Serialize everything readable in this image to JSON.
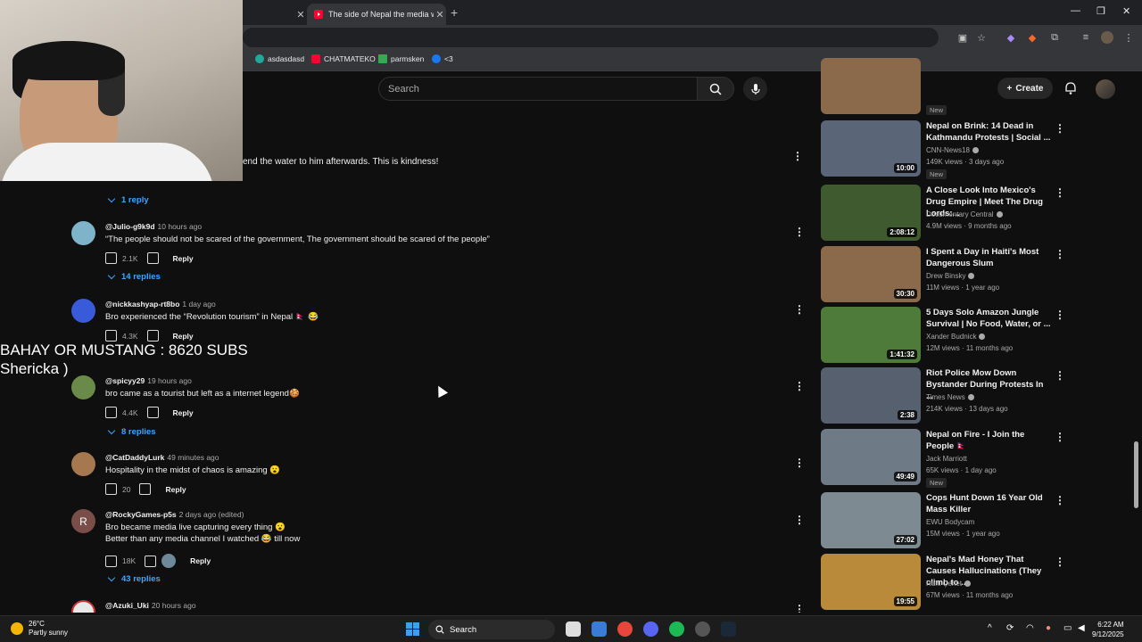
{
  "browser": {
    "active_tab_title": "The side of Nepal the media w...",
    "bookmarks": [
      {
        "label": "asdasdasd",
        "color": "#22a89a"
      },
      {
        "label": "CHATMATEKO",
        "color": "#ff0033"
      },
      {
        "label": "parmsken",
        "color": "#34a853"
      },
      {
        "label": "<3",
        "color": "#1877f2"
      }
    ]
  },
  "header": {
    "search_placeholder": "Search",
    "create_label": "Create"
  },
  "comment_fragment": "end the water to him afterwards.  This is kindness!",
  "comment_fragment_replies": "1 reply",
  "comments": [
    {
      "user": "@Julio-g9k9d",
      "time": "10 hours ago",
      "text": "“The people should not be scared of the government, The government should be scared of the people”",
      "likes": "2.1K",
      "reply": "Reply",
      "replies": "14 replies",
      "avatar_color": "#7fb3c9"
    },
    {
      "user": "@nickkashyap-rt8bo",
      "time": "1 day ago",
      "text": "Bro experienced the “Revolution tourism” in Nepal 🇳🇵 😂",
      "likes": "4.3K",
      "reply": "Reply",
      "replies": "",
      "avatar_color": "#3a5bd9"
    },
    {
      "user": "@spicyy29",
      "time": "19 hours ago",
      "text": "bro came as a tourist but left as a internet legend🍪",
      "likes": "4.4K",
      "reply": "Reply",
      "replies": "8 replies",
      "avatar_color": "#6a8a4a"
    },
    {
      "user": "@CatDaddyLurk",
      "time": "49 minutes ago",
      "text": "Hospitality in the midst of chaos is amazing 😮",
      "likes": "20",
      "reply": "Reply",
      "replies": "",
      "avatar_color": "#a57850"
    },
    {
      "user": "@RockyGames-p5s",
      "time": "2 days ago (edited)",
      "text": "Bro became media live capturing every thing 😮",
      "text2": "Better than any media channel I watched 😂 till now",
      "likes": "18K",
      "reply": "Reply",
      "replies": "43 replies",
      "avatar_color": "#7a4e48",
      "avatar_letter": "R"
    },
    {
      "user": "@Azuki_Uki",
      "time": "20 hours ago",
      "avatar_color": "#e8e8e8"
    }
  ],
  "overlay": {
    "line1": "BAHAY OR MUSTANG : 8620 SUBS",
    "line2": "Shericka )"
  },
  "related": [
    {
      "title": "New",
      "is_badge_only": true
    },
    {
      "title": "Nepal on Brink: 14 Dead in Kathmandu Protests | Social ...",
      "channel": "CNN-News18",
      "meta": "149K views · 3 days ago",
      "duration": "10:00",
      "badge": "New",
      "thumb": "#5a6678"
    },
    {
      "title": "A Close Look Into Mexico's Drug Empire | Meet The Drug Lords:...",
      "channel": "Documentary Central",
      "meta": "4.9M views · 9 months ago",
      "duration": "2:08:12",
      "badge": "",
      "thumb": "#3f5a2e"
    },
    {
      "title": "I Spent a Day in Haiti's Most Dangerous Slum",
      "channel": "Drew Binsky",
      "meta": "11M views · 1 year ago",
      "duration": "30:30",
      "badge": "",
      "thumb": "#8a6a4a"
    },
    {
      "title": "5 Days Solo Amazon Jungle Survival | No Food, Water, or ...",
      "channel": "Xander Budnick",
      "meta": "12M views · 11 months ago",
      "duration": "1:41:32",
      "badge": "",
      "thumb": "#4e7a3a"
    },
    {
      "title": "Riot Police Mow Down Bystander During Protests In ...",
      "channel": "Times News",
      "meta": "214K views · 13 days ago",
      "duration": "2:38",
      "badge": "",
      "thumb": "#56606e"
    },
    {
      "title": "Nepal on Fire - I Join the People 🇳🇵",
      "channel": "Jack Marriott",
      "meta": "65K views · 1 day ago",
      "duration": "49:49",
      "badge": "New",
      "thumb": "#6e7a86"
    },
    {
      "title": "Cops Hunt Down 16 Year Old Mass Killer",
      "channel": "EWU Bodycam",
      "meta": "15M views · 1 year ago",
      "duration": "27:02",
      "badge": "",
      "thumb": "#7d8a92"
    },
    {
      "title": "Nepal's Mad Honey That Causes Hallucinations (They climb to ...",
      "channel": "Ruhi Çenet",
      "meta": "67M views · 11 months ago",
      "duration": "19:55",
      "badge": "",
      "thumb": "#b88a3a"
    }
  ],
  "taskbar": {
    "temp": "26°C",
    "weather": "Partly sunny",
    "search": "Search",
    "time": "6:22 AM",
    "date": "9/12/2025"
  }
}
